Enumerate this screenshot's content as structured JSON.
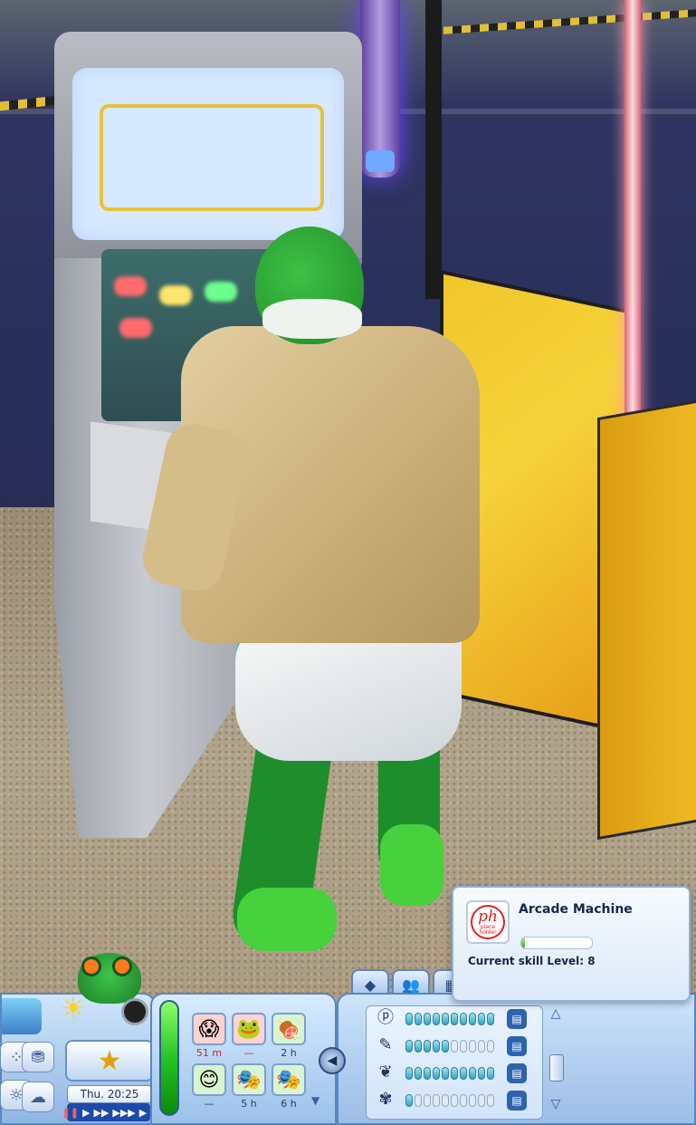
{
  "tooltip": {
    "title": "Arcade Machine",
    "skill_level_label": "Current skill Level: 8",
    "progress": 0.05,
    "icon": "placeholder-icon",
    "icon_text": "ph",
    "icon_subtext": "place holder"
  },
  "clock": {
    "day_time": "Thu. 20:25"
  },
  "moodlets": [
    {
      "icon": "scared-face",
      "time": "51 m",
      "time_color": "red"
    },
    {
      "icon": "frog-face",
      "time": "—",
      "time_color": "red"
    },
    {
      "icon": "meat",
      "time": "2 h",
      "time_color": "normal"
    },
    {
      "icon": "happy-face",
      "time": "—",
      "time_color": "normal"
    },
    {
      "icon": "drama-mask",
      "time": "5 h",
      "time_color": "normal"
    },
    {
      "icon": "theater-mask",
      "time": "6 h",
      "time_color": "normal"
    }
  ],
  "skills": [
    {
      "icon": "placeholder-skill",
      "filled": 10,
      "total": 10
    },
    {
      "icon": "painting-skill",
      "filled": 5,
      "total": 10
    },
    {
      "icon": "fitness-skill",
      "filled": 10,
      "total": 10
    },
    {
      "icon": "charisma-skill",
      "filled": 1,
      "total": 10
    }
  ],
  "tabs": [
    "skills-tab",
    "relationships-tab",
    "career-tab"
  ],
  "colors": {
    "hud_blue": "#9cbde6",
    "accent_green": "#2bb52b",
    "alert_red": "#d2232a"
  }
}
